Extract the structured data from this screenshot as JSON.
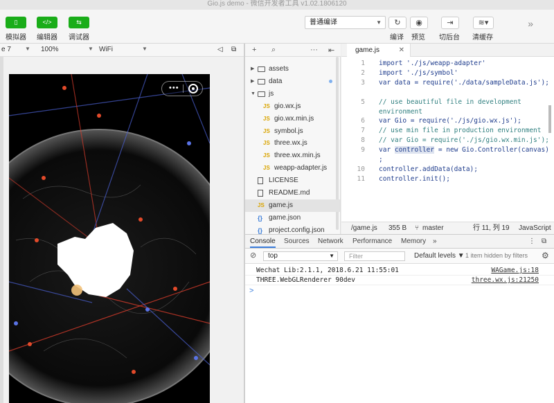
{
  "window": {
    "title": "Gio.js demo - 微信开发者工具 v1.02.1806120"
  },
  "toolbar": {
    "simulator_label": "模拟器",
    "editor_label": "编辑器",
    "debugger_label": "调试器",
    "compile_mode": "普通编译",
    "compile_label": "编译",
    "preview_label": "预览",
    "background_label": "切后台",
    "clear_cache_label": "清缓存",
    "more_icon": "»"
  },
  "simulator": {
    "device": "e 7",
    "zoom": "100%",
    "network": "WiFi",
    "capsule_dots": "•••"
  },
  "file_tree": {
    "items": [
      {
        "type": "folder",
        "label": "assets",
        "expanded": false
      },
      {
        "type": "folder",
        "label": "data",
        "expanded": false
      },
      {
        "type": "folder",
        "label": "js",
        "expanded": true
      },
      {
        "type": "js",
        "label": "gio.wx.js"
      },
      {
        "type": "js",
        "label": "gio.wx.min.js"
      },
      {
        "type": "js",
        "label": "symbol.js"
      },
      {
        "type": "js",
        "label": "three.wx.js"
      },
      {
        "type": "js",
        "label": "three.wx.min.js"
      },
      {
        "type": "js",
        "label": "weapp-adapter.js"
      },
      {
        "type": "file",
        "label": "LICENSE"
      },
      {
        "type": "file",
        "label": "README.md"
      },
      {
        "type": "js",
        "label": "game.js"
      },
      {
        "type": "json",
        "label": "game.json"
      },
      {
        "type": "json",
        "label": "project.config.json"
      }
    ]
  },
  "editor": {
    "tab_label": "game.js",
    "lines": [
      {
        "ln": "1",
        "text": "import './js/weapp-adapter'"
      },
      {
        "ln": "2",
        "text": "import './js/symbol'"
      },
      {
        "ln": "3",
        "text": "var data = require('./data/sampleData.js');"
      },
      {
        "ln": "",
        "text": ""
      },
      {
        "ln": "5",
        "text": "// use beautiful file in development"
      },
      {
        "ln": "",
        "text": "environment"
      },
      {
        "ln": "6",
        "text": "var Gio = require('./js/gio.wx.js');"
      },
      {
        "ln": "7",
        "text": "// use min file in production environment"
      },
      {
        "ln": "8",
        "text": "// var Gio = require('./js/gio.wx.min.js');"
      },
      {
        "ln": "9",
        "text": "var controller = new Gio.Controller(canvas)"
      },
      {
        "ln": "",
        "text": ";"
      },
      {
        "ln": "10",
        "text": "controller.addData(data);"
      },
      {
        "ln": "11",
        "text": "controller.init();"
      }
    ]
  },
  "statusbar": {
    "file": "/game.js",
    "size": "355 B",
    "branch": "master",
    "position": "行 11, 列 19",
    "language": "JavaScript"
  },
  "devtools": {
    "tabs": [
      "Console",
      "Sources",
      "Network",
      "Performance",
      "Memory"
    ],
    "more": "»",
    "context": "top",
    "filter_placeholder": "Filter",
    "levels": "Default levels ▼",
    "hidden_info": "1 item hidden by filters",
    "logs": [
      {
        "msg": "Wechat Lib:2.1.1, 2018.6.21 11:55:01",
        "src": "WAGame.js:18"
      },
      {
        "msg": "THREE.WebGLRenderer 90dev",
        "src": "three.wx.js:21250"
      }
    ],
    "prompt": ">"
  }
}
